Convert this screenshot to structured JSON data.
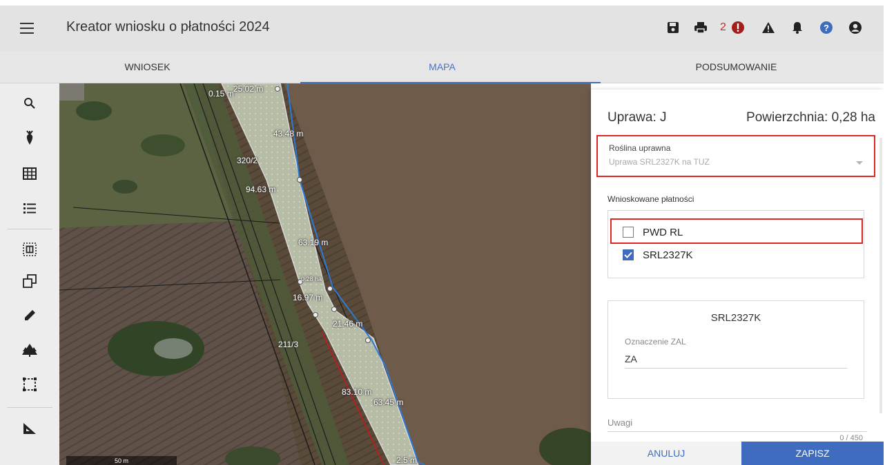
{
  "header": {
    "title": "Kreator wniosku o płatności 2024",
    "alert_count": "2",
    "icons": [
      "menu-icon",
      "save-icon",
      "print-icon",
      "error-icon",
      "warning-icon",
      "bell-icon",
      "help-icon",
      "user-icon"
    ]
  },
  "tabs": [
    {
      "label": "WNIOSEK"
    },
    {
      "label": "MAPA"
    },
    {
      "label": "PODSUMOWANIE"
    }
  ],
  "active_tab": "MAPA",
  "sidebar": {
    "icons": [
      "search-icon",
      "crop-icon",
      "grid-icon",
      "list-icon",
      "select-area-icon",
      "copy-shape-icon",
      "pencil-icon",
      "trees-icon",
      "dashed-rect-icon",
      "measure-icon"
    ]
  },
  "map": {
    "labels": {
      "a": "0.15 m",
      "b": "25.02 m",
      "c": "43.48 m",
      "d": "320/2",
      "e": "94.63 m",
      "f": "63.19 m",
      "g": "0.28 ha",
      "h": "16.97 m",
      "i": "21.46 m",
      "j": "211/3",
      "k": "83.10 m",
      "l": "63.45 m",
      "m": "2.5 m"
    },
    "scale": "50 m"
  },
  "panel": {
    "crop_label": "Uprawa: J",
    "area_label": "Powierzchnia: 0,28 ha",
    "plant_label": "Roślina uprawna",
    "plant_value": "Uprawa SRL2327K na TUZ",
    "payments_label": "Wnioskowane płatności",
    "payments": [
      {
        "label": "PWD RL",
        "checked": false
      },
      {
        "label": "SRL2327K",
        "checked": true
      }
    ],
    "card_title": "SRL2327K",
    "zal_label": "Oznaczenie ZAL",
    "zal_value": "ZA",
    "notes_label": "Uwagi",
    "notes_count": "0 / 450",
    "cancel_label": "ANULUJ",
    "save_label": "ZAPISZ"
  },
  "colors": {
    "accent": "#3f6cbf",
    "highlight": "#e02424",
    "error": "#a31d1d",
    "parcel_border": "#2b7bd6"
  }
}
